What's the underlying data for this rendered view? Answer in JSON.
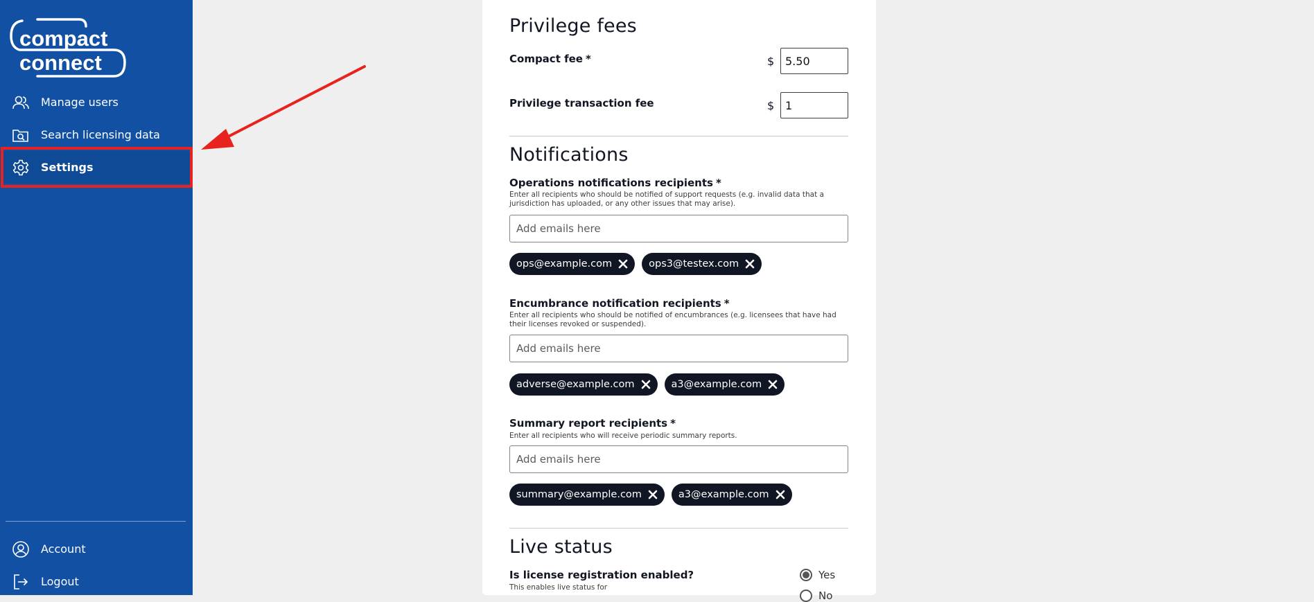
{
  "sidebar": {
    "logo_text_line1": "compact",
    "logo_text_line2": "connect",
    "nav": [
      {
        "label": "Manage users",
        "icon": "users-icon"
      },
      {
        "label": "Search licensing data",
        "icon": "folder-search-icon"
      },
      {
        "label": "Settings",
        "icon": "gear-icon",
        "active": true
      }
    ],
    "bottom": [
      {
        "label": "Account",
        "icon": "account-icon"
      },
      {
        "label": "Logout",
        "icon": "logout-icon"
      }
    ],
    "colors": {
      "background": "#1150a3",
      "highlight": "#e8231f"
    }
  },
  "privilege_fees": {
    "heading": "Privilege fees",
    "compact_fee": {
      "label": "Compact fee",
      "required_mark": "*",
      "currency": "$",
      "value": "5.50"
    },
    "transaction_fee": {
      "label": "Privilege transaction fee",
      "currency": "$",
      "value": "1"
    }
  },
  "notifications": {
    "heading": "Notifications",
    "operations": {
      "label": "Operations notifications recipients",
      "required_mark": "*",
      "help": "Enter all recipients who should be notified of support requests (e.g. invalid data that a jurisdiction has uploaded, or any other issues that may arise).",
      "placeholder": "Add emails here",
      "emails": [
        "ops@example.com",
        "ops3@testex.com"
      ]
    },
    "encumbrance": {
      "label": "Encumbrance notification recipients",
      "required_mark": "*",
      "help": "Enter all recipients who should be notified of encumbrances (e.g. licensees that have had their licenses revoked or suspended).",
      "placeholder": "Add emails here",
      "emails": [
        "adverse@example.com",
        "a3@example.com"
      ]
    },
    "summary": {
      "label": "Summary report recipients",
      "required_mark": "*",
      "help": "Enter all recipients who will receive periodic summary reports.",
      "placeholder": "Add emails here",
      "emails": [
        "summary@example.com",
        "a3@example.com"
      ]
    }
  },
  "live_status": {
    "heading": "Live status",
    "question": "Is license registration enabled?",
    "help": "This enables live status for",
    "options": [
      "Yes",
      "No"
    ],
    "selected": "Yes"
  }
}
